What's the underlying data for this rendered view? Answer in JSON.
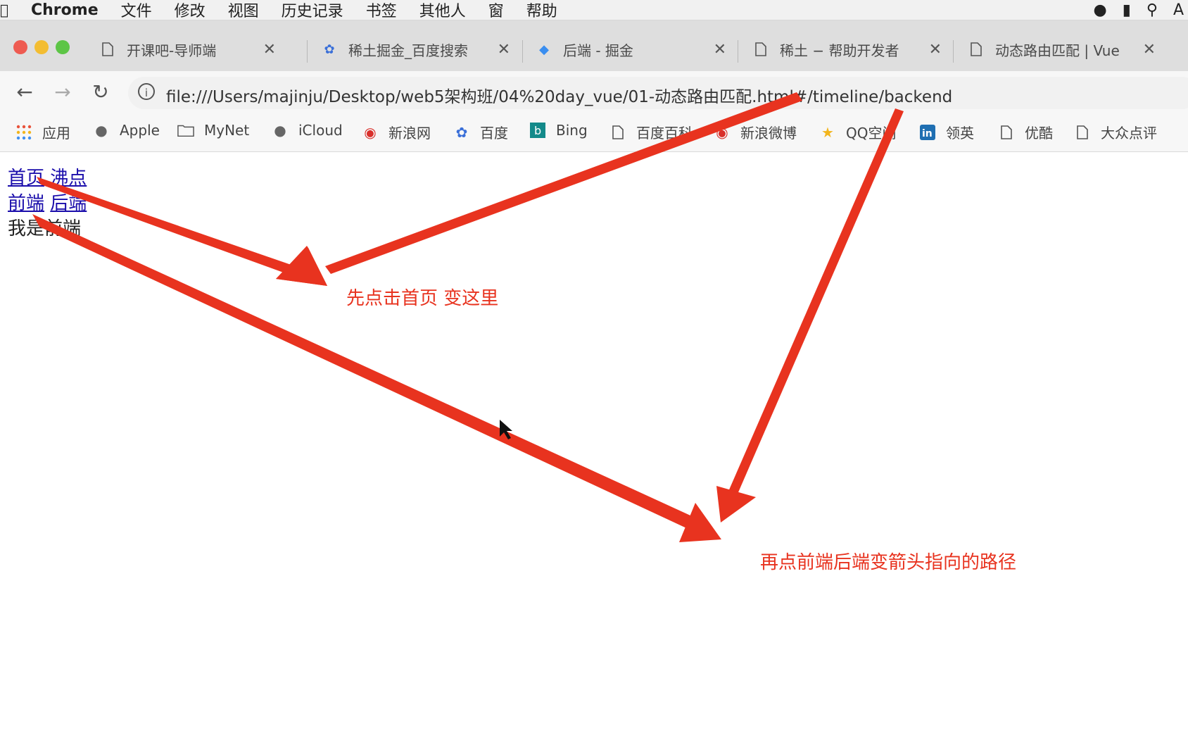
{
  "menubar": {
    "app": "Chrome",
    "items": [
      "文件",
      "修改",
      "视图",
      "历史记录",
      "书签",
      "其他人",
      "窗",
      "帮助"
    ]
  },
  "tabs": [
    {
      "label": "开课吧-导师端",
      "icon": "page-icon"
    },
    {
      "label": "稀土掘金_百度搜索",
      "icon": "baidu-paw-icon"
    },
    {
      "label": "后端 - 掘金",
      "icon": "juejin-icon"
    },
    {
      "label": "稀土 − 帮助开发者",
      "icon": "page-icon"
    },
    {
      "label": "动态路由匹配 | Vue",
      "icon": "page-icon"
    }
  ],
  "address_bar": {
    "url": "file:///Users/majinju/Desktop/web5架构班/04%20day_vue/01-动态路由匹配.html#/timeline/backend"
  },
  "bookmarks": [
    {
      "label": "应用",
      "icon": "apps-grid-icon"
    },
    {
      "label": "Apple",
      "icon": "apple-icon"
    },
    {
      "label": "MyNet",
      "icon": "folder-icon"
    },
    {
      "label": "iCloud",
      "icon": "apple-icon"
    },
    {
      "label": "新浪网",
      "icon": "weibo-icon"
    },
    {
      "label": "百度",
      "icon": "baidu-paw-icon"
    },
    {
      "label": "Bing",
      "icon": "bing-icon"
    },
    {
      "label": "百度百科",
      "icon": "page-icon"
    },
    {
      "label": "新浪微博",
      "icon": "weibo-icon"
    },
    {
      "label": "QQ空间",
      "icon": "star-icon"
    },
    {
      "label": "领英",
      "icon": "linkedin-icon"
    },
    {
      "label": "优酷",
      "icon": "page-icon"
    },
    {
      "label": "大众点评",
      "icon": "page-icon"
    }
  ],
  "page": {
    "nav_links": [
      "首页",
      "沸点"
    ],
    "sub_links": [
      "前端",
      "后端"
    ],
    "content_text": "我是前端"
  },
  "annotations": {
    "first": "先点击首页 变这里",
    "second": "再点前端后端变箭头指向的路径"
  },
  "colors": {
    "annotation": "#e8331f",
    "link": "#1a0dab"
  }
}
